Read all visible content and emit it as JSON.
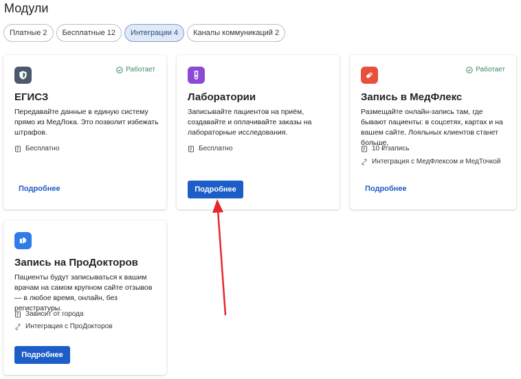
{
  "page": {
    "title": "Модули"
  },
  "tabs": [
    {
      "label": "Платные 2",
      "active": false
    },
    {
      "label": "Бесплатные 12",
      "active": false
    },
    {
      "label": "Интеграции 4",
      "active": true
    },
    {
      "label": "Каналы коммуникаций 2",
      "active": false
    }
  ],
  "cards": [
    {
      "icon": "shield-icon",
      "icon_color": "#4a5a6c",
      "status": "Работает",
      "title": "ЕГИСЗ",
      "description": "Передавайте данные в единую систему прямо из МедЛока. Это позволит избежать штрафов.",
      "price": "Бесплатно",
      "button": "Подробнее"
    },
    {
      "icon": "test-tube-icon",
      "icon_color": "#8a4ad6",
      "title": "Лаборатории",
      "description": "Записывайте пациентов на приём, создавайте и оплачивайте заказы на лабораторные исследования.",
      "price": "Бесплатно",
      "button": "Подробнее"
    },
    {
      "icon": "medflex-icon",
      "icon_color": "#e8503a",
      "status": "Работает",
      "title": "Запись в МедФлекс",
      "description": "Размещайте онлайн-запись там, где бывают пациенты: в соцсетях, картах и на вашем сайте. Лояльных клиентов станет больше.",
      "price": "10 ₽/запись",
      "integration": "Интеграция с МедФлексом и МедТочкой",
      "button": "Подробнее"
    },
    {
      "icon": "prodoctorov-icon",
      "icon_color": "#2f7be8",
      "title": "Запись на ПроДокторов",
      "description": "Пациенты будут записываться к вашим врачам на самом крупном сайте отзывов — в любое время, онлайн, без регистратуры.",
      "price": "Зависит от города",
      "integration": "Интеграция с ПроДокторов",
      "button": "Подробнее"
    }
  ],
  "colors": {
    "accent": "#1c5dc7",
    "status_green": "#3a8a5a",
    "annotation_arrow": "#e8262a"
  }
}
